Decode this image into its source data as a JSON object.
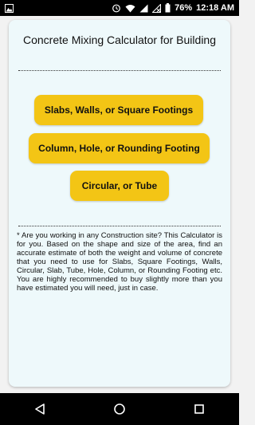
{
  "status_bar": {
    "battery": "76%",
    "time": "12:18 AM",
    "icons": [
      "gallery-icon",
      "alarm-icon",
      "wifi-icon",
      "cellular-signal-icon",
      "no-signal-icon",
      "battery-icon"
    ]
  },
  "app": {
    "title": "Concrete Mixing Calculator for Building",
    "buttons": {
      "slabs": "Slabs, Walls, or Square Footings",
      "column": "Column, Hole, or Rounding Footing",
      "circular": "Circular, or Tube"
    },
    "info_text": "* Are you working in any Construction site? This Calculator is for you. Based on the shape and size of the area, find an accurate estimate of both the weight and volume of concrete that you need to use for Slabs, Square Footings, Walls, Circular, Slab, Tube, Hole, Column, or Rounding Footing etc. You are highly recommended to buy slightly more than you have estimated you will need, just in case."
  },
  "colors": {
    "button": "#f3c515",
    "card": "#eef9fb",
    "bars": "#000000"
  },
  "nav": [
    "back-icon",
    "home-icon",
    "recents-icon"
  ]
}
